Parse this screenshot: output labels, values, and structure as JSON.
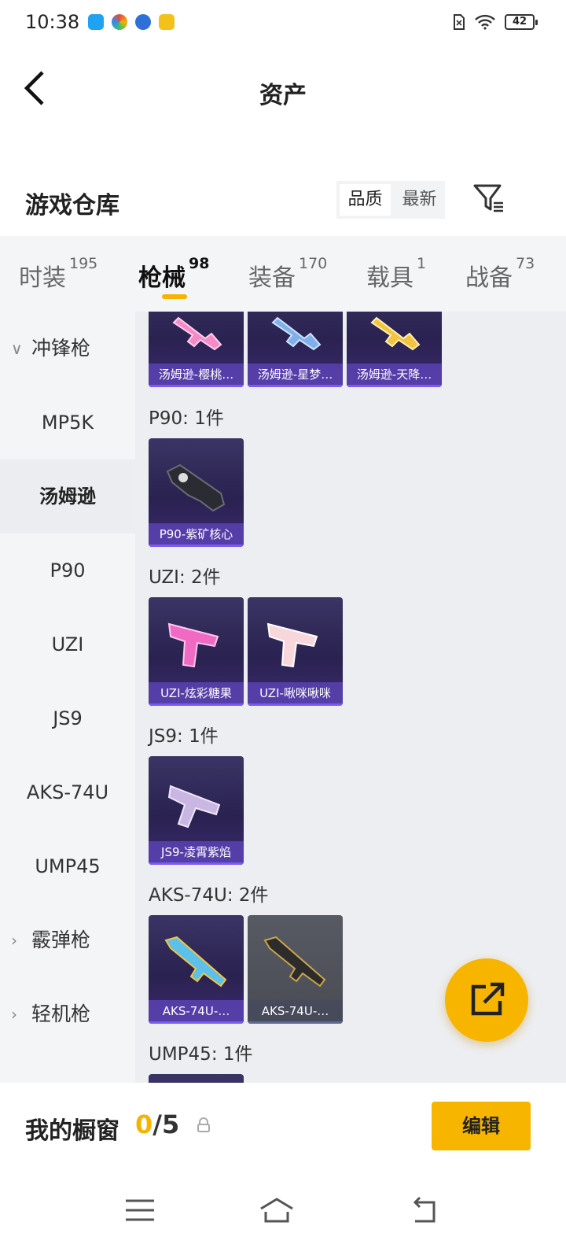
{
  "status_bar": {
    "time": "10:38",
    "battery": "42"
  },
  "header": {
    "title": "资产"
  },
  "warehouse": {
    "title": "游戏仓库",
    "sort_options": [
      "品质",
      "最新"
    ]
  },
  "tabs": [
    {
      "label": "时装",
      "count": "195"
    },
    {
      "label": "枪械",
      "count": "98"
    },
    {
      "label": "装备",
      "count": "170"
    },
    {
      "label": "载具",
      "count": "1"
    },
    {
      "label": "战备",
      "count": "73"
    }
  ],
  "sidebar": {
    "items": [
      {
        "label": "冲锋枪",
        "type": "group"
      },
      {
        "label": "MP5K",
        "type": "sub"
      },
      {
        "label": "汤姆逊",
        "type": "sub"
      },
      {
        "label": "P90",
        "type": "sub"
      },
      {
        "label": "UZI",
        "type": "sub"
      },
      {
        "label": "JS9",
        "type": "sub"
      },
      {
        "label": "AKS-74U",
        "type": "sub"
      },
      {
        "label": "UMP45",
        "type": "sub"
      },
      {
        "label": "霰弹枪",
        "type": "group"
      },
      {
        "label": "轻机枪",
        "type": "group"
      }
    ]
  },
  "content": {
    "thompson_cards": [
      "汤姆逊-樱桃…",
      "汤姆逊-星梦…",
      "汤姆逊-天降…"
    ],
    "sections": [
      {
        "title": "P90: 1件",
        "cards": [
          "P90-紫矿核心"
        ]
      },
      {
        "title": "UZI: 2件",
        "cards": [
          "UZI-炫彩糖果",
          "UZI-啾咪啾咪"
        ]
      },
      {
        "title": "JS9: 1件",
        "cards": [
          "JS9-凌霄紫焰"
        ]
      },
      {
        "title": "AKS-74U: 2件",
        "cards": [
          "AKS-74U-…",
          "AKS-74U-…"
        ]
      },
      {
        "title": "UMP45: 1件",
        "cards": []
      }
    ]
  },
  "bottom": {
    "showcase_label": "我的橱窗",
    "showcase_current": "0",
    "showcase_total": "/5",
    "edit_label": "编辑"
  },
  "colors": {
    "accent": "#f7b500",
    "card_bg": "#2a2250",
    "card_label": "#6046be"
  }
}
